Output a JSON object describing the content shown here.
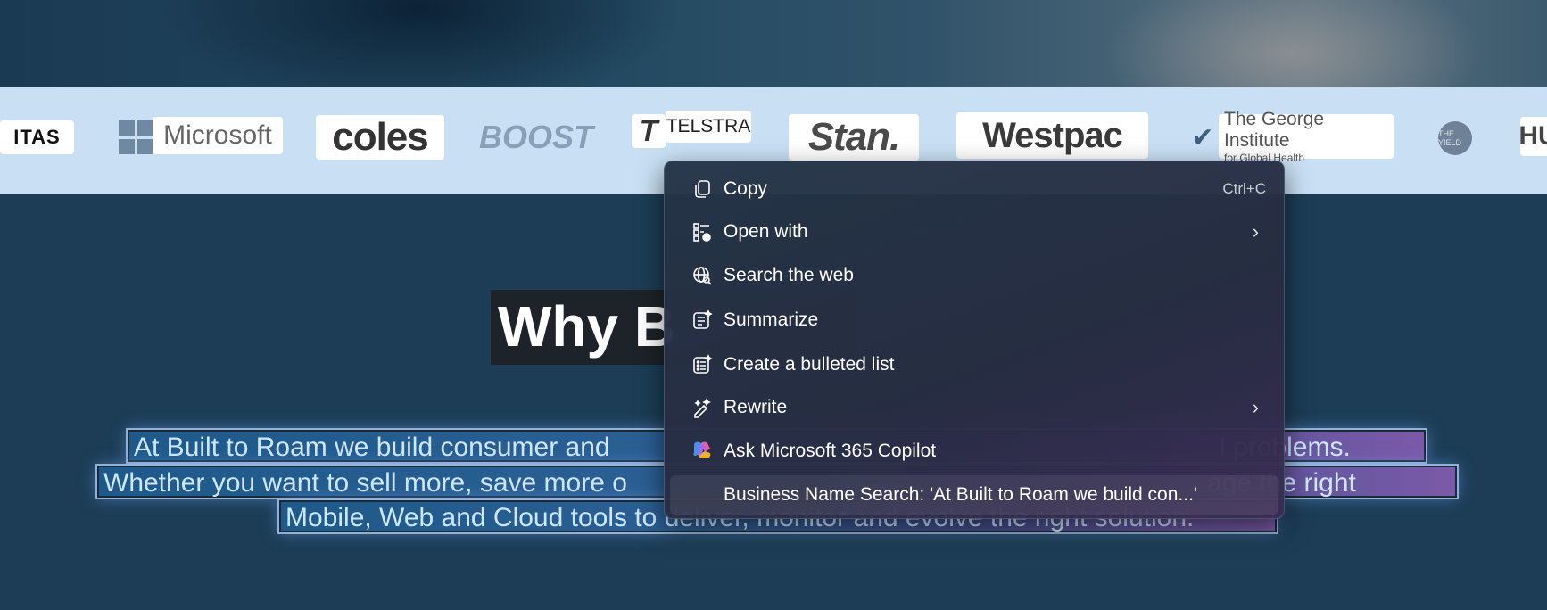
{
  "logos": {
    "qantas": "ITAS",
    "microsoft": "Microsoft",
    "coles": "coles",
    "boost": "BOOST",
    "telstra_mark": "T",
    "telstra": "TELSTRA",
    "stan": "Stan.",
    "westpac": "Westpac",
    "george_line1": "The George Institute",
    "george_line2": "for Global Health",
    "yield": "THE YIELD",
    "hu": "HU"
  },
  "page": {
    "heading": "Why B",
    "paragraph_line1": "At Built to Roam we build consumer and                                                                                  l problems.",
    "paragraph_line2": "Whether you want to sell more, save more o                                                                              age the right",
    "paragraph_line3": "Mobile, Web and Cloud tools to deliver, monitor and evolve the right solution."
  },
  "context_menu": {
    "items": [
      {
        "label": "Copy",
        "shortcut": "Ctrl+C",
        "icon": "copy-icon"
      },
      {
        "label": "Open with",
        "icon": "open-with-icon",
        "submenu": true
      },
      {
        "label": "Search the web",
        "icon": "globe-search-icon"
      },
      {
        "label": "Summarize",
        "icon": "summarize-icon"
      },
      {
        "label": "Create a bulleted list",
        "icon": "bulleted-list-icon"
      },
      {
        "label": "Rewrite",
        "icon": "rewrite-icon",
        "submenu": true
      },
      {
        "label": "Ask Microsoft 365 Copilot",
        "icon": "copilot-icon"
      },
      {
        "label": "Business Name Search: 'At Built to Roam we build con...'"
      }
    ],
    "submenu_chevron": "›"
  }
}
